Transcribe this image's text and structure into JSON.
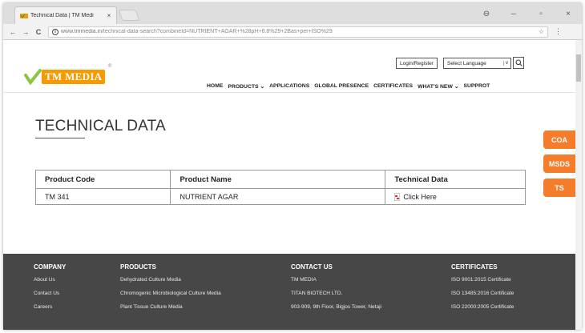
{
  "browser": {
    "tab_title": "Technical Data | TM Medi",
    "tab_close": "×",
    "url_host": "www.tmmedia.in",
    "url_path": "/technical-data-search?combineId=NUTRIENT+AGAR+%28pH+6.8%29+2Bas+per+ISO%29",
    "controls": {
      "back": "←",
      "forward": "→",
      "reload": "C",
      "star": "☆",
      "menu": "⋮"
    },
    "window": {
      "account": "⊖",
      "minimize": "–",
      "maximize": "▫",
      "close": "×"
    }
  },
  "header": {
    "logo_text": "TM MEDIA",
    "logo_reg": "®",
    "login_label": "Login/Register",
    "language_label": "Select Language",
    "language_caret": "v",
    "search_icon": "search-icon",
    "nav": [
      {
        "label": "HOME"
      },
      {
        "label": "PRODUCTS ⌄"
      },
      {
        "label": "APPLICATIONS"
      },
      {
        "label": "GLOBAL PRESENCE"
      },
      {
        "label": "CERTIFICATES"
      },
      {
        "label": "WHAT'S NEW ⌄"
      },
      {
        "label": "SUPPROT"
      }
    ]
  },
  "page": {
    "title": "TECHNICAL DATA",
    "table": {
      "headers": [
        "Product Code",
        "Product Name",
        "Technical Data"
      ],
      "rows": [
        {
          "code": "TM 341",
          "name": "NUTRIENT AGAR",
          "link": "Click Here"
        }
      ]
    }
  },
  "side_buttons": [
    "COA",
    "MSDS",
    "TS"
  ],
  "footer": {
    "company": {
      "title": "COMPANY",
      "links": [
        "About Us",
        "Contact Us",
        "Careers"
      ]
    },
    "products": {
      "title": "PRODUCTS",
      "links": [
        "Dehydrated Culture Media",
        "Chromogenic Microbiological Culture Media",
        "Plant Tissue Culture Media"
      ]
    },
    "contact": {
      "title": "CONTACT US",
      "links": [
        "TM MEDIA",
        "TITAN BIOTECH LTD.",
        "903-909, 9th Floor, Bigjos Tower, Netaji"
      ]
    },
    "certificates": {
      "title": "CERTIFICATES",
      "links": [
        "ISO 9001:2015 Certificate",
        "ISO 13485:2016 Certificate",
        "ISO 22000:2005 Certificate"
      ]
    }
  },
  "colors": {
    "brand_orange": "#f59a00",
    "side_button": "#f57c2a",
    "footer_bg": "#474747"
  }
}
